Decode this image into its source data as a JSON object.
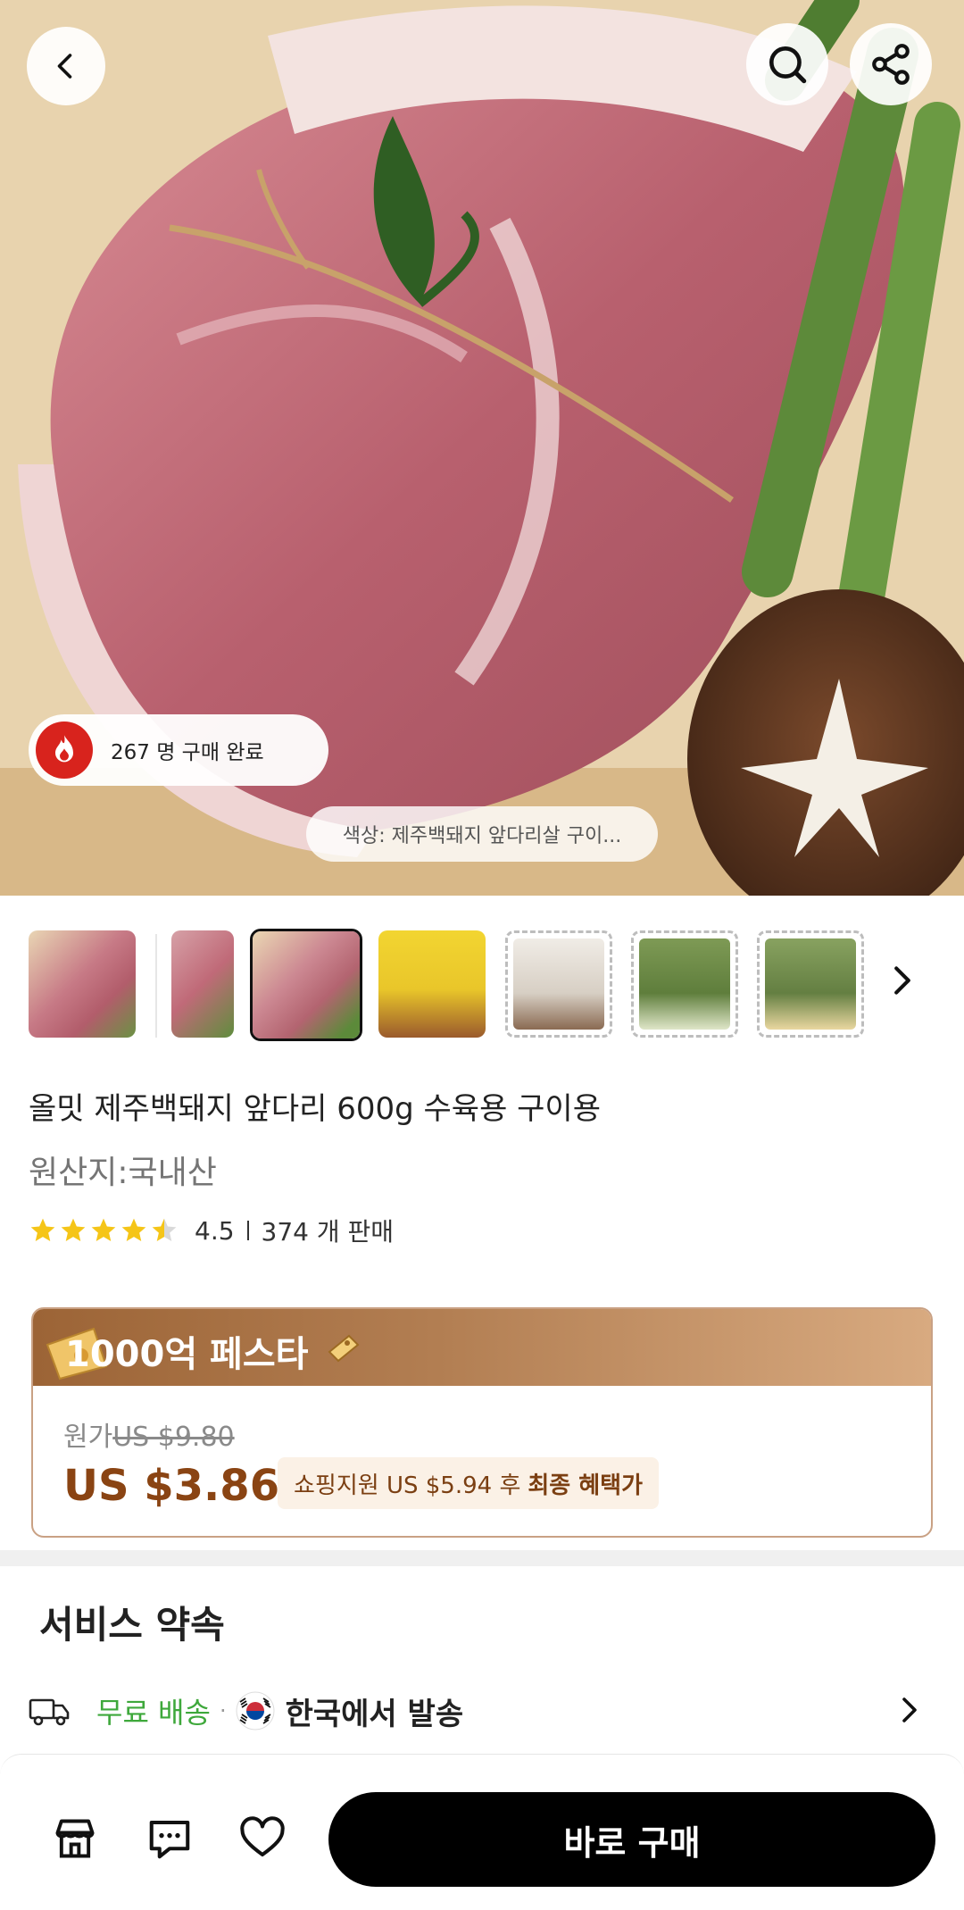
{
  "hero": {
    "buyers_text": "267 명 구매 완료",
    "color_option_text": "색상: 제주백돼지 앞다리살 구이..."
  },
  "header": {
    "back_icon": "chevron-left-icon",
    "search_icon": "search-icon",
    "share_icon": "share-icon"
  },
  "thumbnails": {
    "count": 7,
    "selected_index": 2,
    "more_icon": "chevron-right-icon"
  },
  "product": {
    "title": "올밋 제주백돼지 앞다리 600g 수육용 구이용",
    "origin": "원산지:국내산",
    "rating": "4.5",
    "rating_stars": 4.5,
    "sold": "374 개 판매"
  },
  "festa": {
    "title": "1000억 페스타",
    "original_label": "원가",
    "original_price": "US $9.80",
    "price": "US $3.86",
    "coupon_text": "쇼핑지원 US $5.94 후",
    "coupon_bold": "최종 혜택가"
  },
  "service": {
    "title": "서비스 약속",
    "free_shipping": "무료 배송",
    "separator": "·",
    "ship_from": "한국에서 발송"
  },
  "bottom_bar": {
    "store_icon": "store-icon",
    "chat_icon": "chat-icon",
    "wishlist_icon": "heart-icon",
    "buy_label": "바로 구매"
  },
  "colors": {
    "price_brown": "#8a4413",
    "festa_header": "#b27e52",
    "free_green": "#3ea83b",
    "flame_red": "#d8231d"
  }
}
